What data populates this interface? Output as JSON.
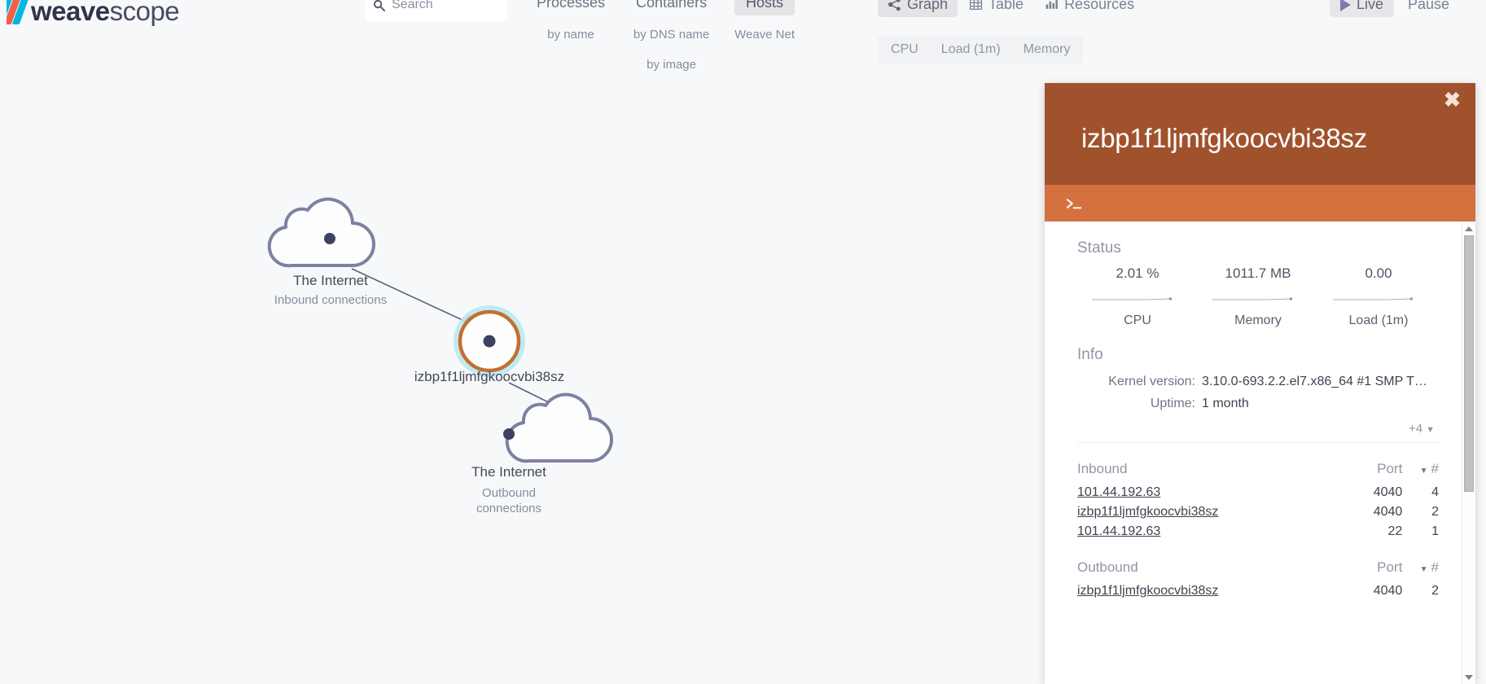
{
  "brand": {
    "name_bold": "weave",
    "name_light": "scope"
  },
  "search": {
    "placeholder": "Search",
    "value": "",
    "icon": "search-icon"
  },
  "topology": {
    "columns": [
      {
        "label": "Processes",
        "selected": false,
        "subs": [
          {
            "label": "by name",
            "selected": false
          }
        ]
      },
      {
        "label": "Containers",
        "selected": false,
        "subs": [
          {
            "label": "by DNS name",
            "selected": false
          },
          {
            "label": "by image",
            "selected": false
          }
        ]
      },
      {
        "label": "Hosts",
        "selected": true,
        "subs": [
          {
            "label": "Weave Net",
            "selected": false
          }
        ]
      }
    ]
  },
  "view_controls": {
    "buttons": [
      {
        "label": "Graph",
        "icon": "share-graph-icon",
        "selected": true
      },
      {
        "label": "Table",
        "icon": "table-grid-icon",
        "selected": false
      },
      {
        "label": "Resources",
        "icon": "bar-chart-icon",
        "selected": false
      }
    ],
    "metrics": [
      {
        "label": "CPU",
        "selected": false
      },
      {
        "label": "Load (1m)",
        "selected": false
      },
      {
        "label": "Memory",
        "selected": false
      }
    ]
  },
  "time_controls": {
    "buttons": [
      {
        "label": "Live",
        "icon": "play-icon",
        "selected": true
      },
      {
        "label": "Pause",
        "icon": "pause-icon",
        "selected": false
      }
    ]
  },
  "graph": {
    "nodes": [
      {
        "id": "internet-in",
        "shape": "cloud",
        "label": "The Internet",
        "sublabel": "Inbound connections",
        "selected": false
      },
      {
        "id": "host",
        "shape": "circle",
        "label": "izbp1f1ljmfgkoocvbi38sz",
        "sublabel": "",
        "selected": true
      },
      {
        "id": "internet-out",
        "shape": "cloud",
        "label": "The Internet",
        "sublabel_line1": "Outbound",
        "sublabel_line2": "connections",
        "selected": false
      }
    ],
    "colors": {
      "node_outline": "#7d81a0",
      "selected_ring": "#b5e8f2",
      "selected_border": "#c2702f",
      "node_dot": "#3c4260",
      "edge": "#5c6080"
    }
  },
  "panel": {
    "title": "izbp1f1ljmfgkoocvbi38sz",
    "close_label": "✖",
    "header_color": "#a0522d",
    "toolbar_color": "#d4713f",
    "toolbar": {
      "terminal_label": "terminal-icon"
    },
    "status": {
      "section_label": "Status",
      "metrics": [
        {
          "name": "CPU",
          "value": "2.01 %"
        },
        {
          "name": "Memory",
          "value": "1011.7 MB"
        },
        {
          "name": "Load (1m)",
          "value": "0.00"
        }
      ]
    },
    "info": {
      "section_label": "Info",
      "rows": [
        {
          "key": "Kernel version:",
          "value": "3.10.0-693.2.2.el7.x86_64 #1 SMP T…"
        },
        {
          "key": "Uptime:",
          "value": "1 month"
        }
      ],
      "expander_label": "+4",
      "expander_caret": "▼"
    },
    "inbound": {
      "title": "Inbound",
      "col_port": "Port",
      "col_count": "#",
      "sort_caret": "▼",
      "rows": [
        {
          "endpoint": "101.44.192.63",
          "port": "4040",
          "count": "4"
        },
        {
          "endpoint": "izbp1f1ljmfgkoocvbi38sz",
          "port": "4040",
          "count": "2"
        },
        {
          "endpoint": "101.44.192.63",
          "port": "22",
          "count": "1"
        }
      ]
    },
    "outbound": {
      "title": "Outbound",
      "col_port": "Port",
      "col_count": "#",
      "sort_caret": "▼",
      "rows": [
        {
          "endpoint": "izbp1f1ljmfgkoocvbi38sz",
          "port": "4040",
          "count": "2"
        }
      ]
    }
  }
}
